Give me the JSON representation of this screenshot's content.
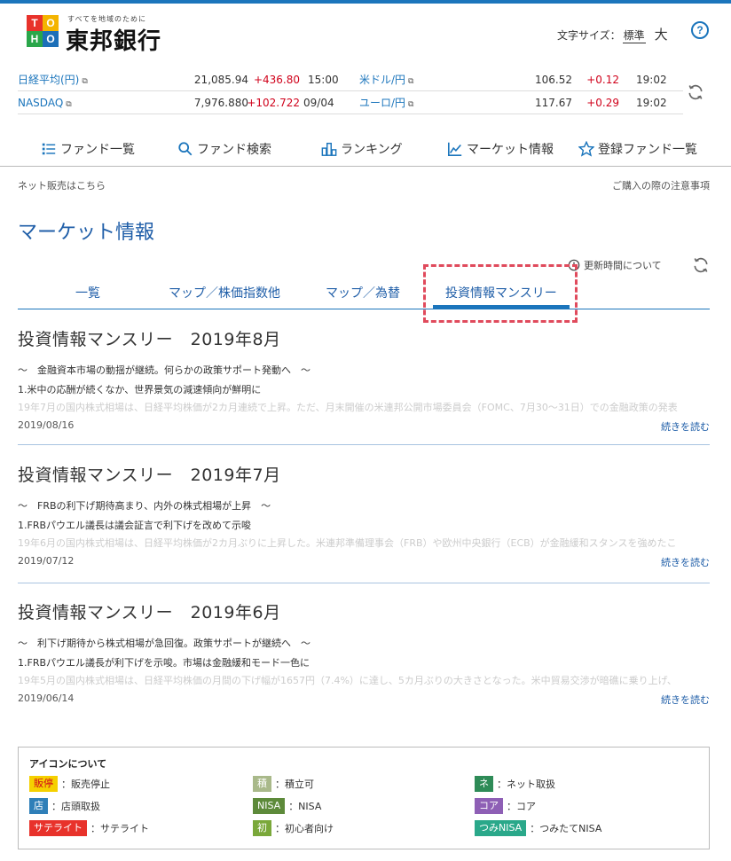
{
  "header": {
    "tagline": "すべてを地域のために",
    "bank_name": "東邦銀行",
    "logo_letters": [
      "T",
      "O",
      "H",
      "O"
    ],
    "font_size_label": "文字サイズ：",
    "font_size_standard": "標準",
    "font_size_large": "大",
    "help_label": "?"
  },
  "ticker": [
    {
      "name": "日経平均(円)",
      "value": "21,085.94",
      "change": "+436.80",
      "time": "15:00"
    },
    {
      "name": "米ドル/円",
      "value": "106.52",
      "change": "+0.12",
      "time": "19:02"
    },
    {
      "name": "NASDAQ",
      "value": "7,976.880",
      "change": "+102.722",
      "time": "09/04"
    },
    {
      "name": "ユーロ/円",
      "value": "117.67",
      "change": "+0.29",
      "time": "19:02"
    }
  ],
  "nav": {
    "items": [
      {
        "label": "ファンド一覧",
        "icon": "list-icon"
      },
      {
        "label": "ファンド検索",
        "icon": "search-icon"
      },
      {
        "label": "ランキング",
        "icon": "ranking-icon"
      },
      {
        "label": "マーケット情報",
        "icon": "chart-icon"
      },
      {
        "label": "登録ファンド一覧",
        "icon": "star-icon"
      }
    ]
  },
  "subnav": {
    "left": "ネット販売はこちら",
    "right": "ご購入の際の注意事項"
  },
  "page_title": "マーケット情報",
  "update_info": "更新時間について",
  "tabs": [
    {
      "label": "一覧"
    },
    {
      "label": "マップ／株価指数他"
    },
    {
      "label": "マップ／為替"
    },
    {
      "label": "投資情報マンスリー"
    }
  ],
  "articles": [
    {
      "title": "投資情報マンスリー　2019年8月",
      "subtitle": "～　金融資本市場の動揺が継続。何らかの政策サポート発動へ　～",
      "heading": "1.米中の応酬が続くなか、世界景気の減速傾向が鮮明に",
      "preview": "19年7月の国内株式相場は、日経平均株価が2カ月連続で上昇。ただ、月末開催の米連邦公開市場委員会（FOMC、7月30～31日）での金融政策の発表",
      "date": "2019/08/16",
      "more": "続きを読む"
    },
    {
      "title": "投資情報マンスリー　2019年7月",
      "subtitle": "～　FRBの利下げ期待高まり、内外の株式相場が上昇　～",
      "heading": "1.FRBパウエル議長は議会証言で利下げを改めて示唆",
      "preview": "19年6月の国内株式相場は、日経平均株価が2カ月ぶりに上昇した。米連邦準備理事会（FRB）や欧州中央銀行（ECB）が金融緩和スタンスを強めたこ",
      "date": "2019/07/12",
      "more": "続きを読む"
    },
    {
      "title": "投資情報マンスリー　2019年6月",
      "subtitle": "～　利下げ期待から株式相場が急回復。政策サポートが継続へ　～",
      "heading": "1.FRBパウエル議長が利下げを示唆。市場は金融緩和モード一色に",
      "preview": "19年5月の国内株式相場は、日経平均株価の月間の下げ幅が1657円（7.4%）に達し、5カ月ぶりの大きさとなった。米中貿易交渉が暗礁に乗り上げ、",
      "date": "2019/06/14",
      "more": "続きを読む"
    }
  ],
  "legend": {
    "title": "アイコンについて",
    "items": [
      {
        "badge": "販停",
        "desc": "：販売停止",
        "color": "#f5d000",
        "text_color": "#d0021b"
      },
      {
        "badge": "積",
        "desc": "：積立可",
        "color": "#a9b98a",
        "text_color": "#ffffff"
      },
      {
        "badge": "ネ",
        "desc": "：ネット取扱",
        "color": "#2e8b57",
        "text_color": "#ffffff"
      },
      {
        "badge": "店",
        "desc": "：店頭取扱",
        "color": "#2f7fb8",
        "text_color": "#ffffff"
      },
      {
        "badge": "NISA",
        "desc": "：NISA",
        "color": "#5d8a3a",
        "text_color": "#ffffff"
      },
      {
        "badge": "コア",
        "desc": "：コア",
        "color": "#8e5fb5",
        "text_color": "#ffffff"
      },
      {
        "badge": "サテライト",
        "desc": "：サテライト",
        "color": "#e8322b",
        "text_color": "#ffffff"
      },
      {
        "badge": "初",
        "desc": "：初心者向け",
        "color": "#7aa83a",
        "text_color": "#ffffff"
      },
      {
        "badge": "つみNISA",
        "desc": "：つみたてNISA",
        "color": "#2aa88a",
        "text_color": "#ffffff"
      }
    ]
  },
  "colors": {
    "accent": "#1b75bc",
    "title": "#1f5ea8",
    "positive_change": "#d0021b",
    "highlight_box": "#e04a5c"
  }
}
